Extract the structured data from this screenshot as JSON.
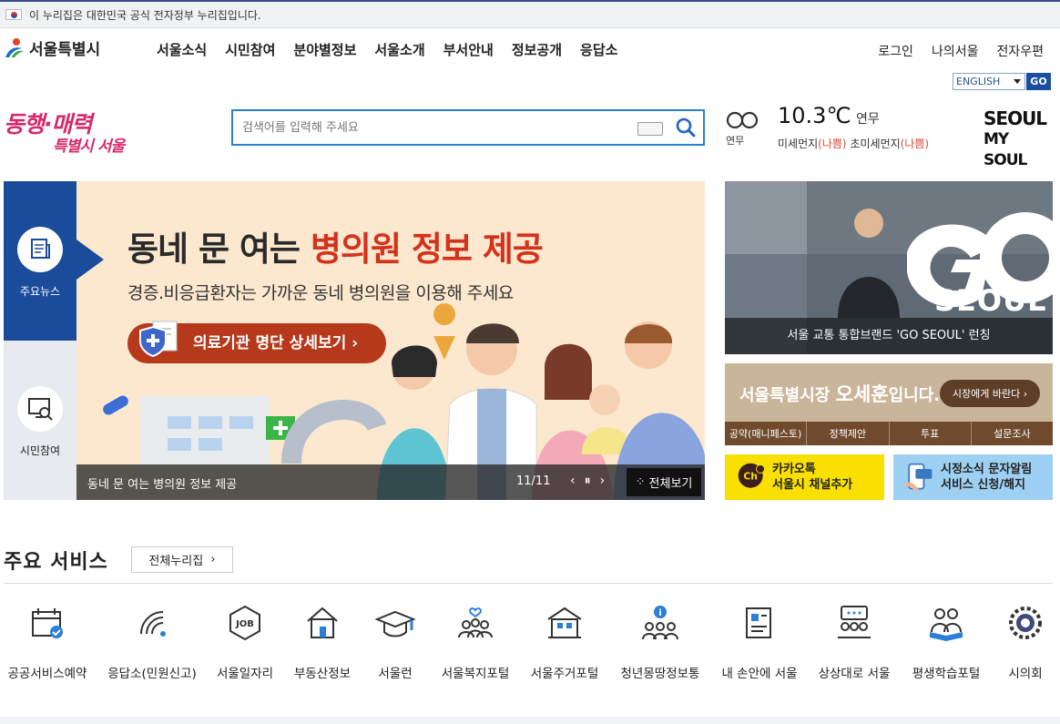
{
  "gov_notice": "이 누리집은 대한민국 공식 전자정부 누리집입니다.",
  "logo": "서울특별시",
  "gnb": [
    "서울소식",
    "시민참여",
    "분야별정보",
    "서울소개",
    "부서안내",
    "정보공개",
    "응답소"
  ],
  "util": [
    "로그인",
    "나의서울",
    "전자우편"
  ],
  "language": {
    "selected": "ENGLISH",
    "go": "GO"
  },
  "slogan": {
    "line1": "동행·매력",
    "line2": "특별시 서울"
  },
  "search": {
    "placeholder": "검색어를 입력해 주세요"
  },
  "weather": {
    "icon_label": "연무",
    "temp": "10.3℃",
    "desc": "연무",
    "dust_label": "미세먼지",
    "dust_value": "(나쁨)",
    "ultra_label": "초미세먼지",
    "ultra_value": "(나쁨)"
  },
  "brand": {
    "line1": "SEOUL",
    "line2": "MY SOUL"
  },
  "tabs": [
    "주요뉴스",
    "시민참여"
  ],
  "banner": {
    "title_a": "동네 문 여는 ",
    "title_b": "병의원 정보 제공",
    "subtitle": "경증.비응급환자는 가까운 동네 병의원을 이용해 주세요",
    "button": "의료기관 명단 상세보기",
    "caption": "동네 문 여는 병의원 정보 제공",
    "counter": "11/11",
    "all": "전체보기"
  },
  "news": {
    "caption": "서울 교통 통합브랜드 'GO SEOUL' 런칭",
    "logo_big": "GO",
    "logo_small": "SEOUL"
  },
  "mayor": {
    "text_a": "서울특별시장 ",
    "name": "오세훈",
    "text_b": "입니다.",
    "button": "시장에게 바란다 ›",
    "tabs": [
      "공약(매니페스토)",
      "정책제안",
      "투표",
      "설문조사"
    ]
  },
  "quick": [
    {
      "line1": "카카오톡",
      "line2": "서울시 채널추가"
    },
    {
      "line1": "시정소식 문자알림",
      "line2": "서비스 신청/해지"
    }
  ],
  "services": {
    "heading": "주요 서비스",
    "all": "전체누리집",
    "items": [
      "공공서비스예약",
      "응답소(민원신고)",
      "서울일자리",
      "부동산정보",
      "서울런",
      "서울복지포털",
      "서울주거포털",
      "청년몽땅정보통",
      "내 손안에 서울",
      "상상대로 서울",
      "평생학습포털",
      "시의회"
    ]
  },
  "colors": {
    "primary": "#1a4c9b",
    "banner_bg": "#fbe8cf",
    "accent_red": "#d3321b",
    "button_brown": "#b7391c",
    "kakao": "#f9e000",
    "sms": "#9dd0f2",
    "search_border": "#2b80d2"
  }
}
